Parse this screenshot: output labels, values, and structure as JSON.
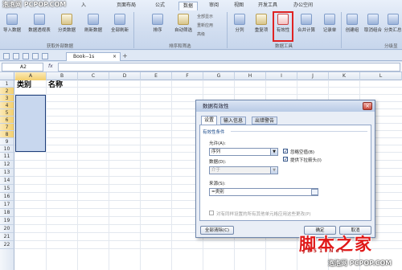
{
  "watermark_top": "泡泡网 PCPOP.COM",
  "tabs": [
    "入",
    "页面布局",
    "公式",
    "数据",
    "审阅",
    "视图",
    "开发工具",
    "办公空间"
  ],
  "ribbon": {
    "buttons": [
      "导入数据",
      "数据透视表",
      "分类数据",
      "刷新数据",
      "全部刷新",
      "排序",
      "自动筛选",
      "高级",
      "分列",
      "重复项",
      "有效性",
      "合并计算",
      "记录单",
      "创建组",
      "取消组合",
      "分类汇总"
    ],
    "sort_small": [
      "全部显示",
      "重新应用"
    ],
    "groups": [
      "获取外部数据",
      "排序和筛选",
      "数据工具",
      "分级显"
    ]
  },
  "doc_tab": "Book--1s",
  "doc_tab_close": "×",
  "doc_tab_add": "+",
  "name_box": "A2",
  "fx": "fx",
  "columns": [
    "A",
    "B",
    "C",
    "D",
    "E",
    "F",
    "G",
    "H",
    "I",
    "J",
    "K",
    "L"
  ],
  "rows": [
    "1",
    "2",
    "3",
    "4",
    "5",
    "6",
    "7",
    "8",
    "9",
    "10",
    "11",
    "12",
    "13",
    "14",
    "15",
    "16",
    "17",
    "18",
    "19",
    "20",
    "21",
    "22"
  ],
  "cells": {
    "a1": "类别",
    "b1": "名称"
  },
  "dialog": {
    "title": "数据有效性",
    "close": "×",
    "tabs": [
      "设置",
      "输入信息",
      "出错警告"
    ],
    "criteria_label": "有效性条件",
    "allow_label": "允许(A):",
    "allow_value": "序列",
    "data_label": "数据(D):",
    "data_value": "介于",
    "ignore_blank": "忽略空值(B)",
    "dropdown": "提供下拉箭头(I)",
    "source_label": "来源(S):",
    "source_value": "=类别",
    "apply_all": "对有同样设置的所有其他单元格应用这些更改(P)",
    "clear_all": "全部清除(C)",
    "ok": "确定",
    "cancel": "取消"
  },
  "watermark_logo": "脚本之家",
  "watermark_logo_sub": "JB51.Net",
  "watermark_bottom": "泡泡网 PCPOP.COM"
}
